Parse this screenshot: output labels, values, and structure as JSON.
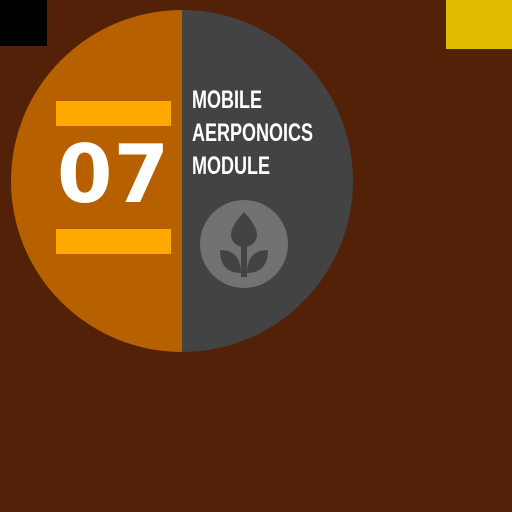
{
  "badge": {
    "number": "07",
    "title_lines": [
      "MOBILE",
      "AERPONOICS",
      "MODULE"
    ],
    "icon": "sprout-leaf-icon"
  },
  "colors": {
    "background": "#532108",
    "badge_left": "#B76000",
    "badge_right": "#434343",
    "bars": "#FFA800",
    "corner_black": "#000000",
    "corner_yellow": "#E0BC00",
    "text": "#FFFFFF"
  }
}
